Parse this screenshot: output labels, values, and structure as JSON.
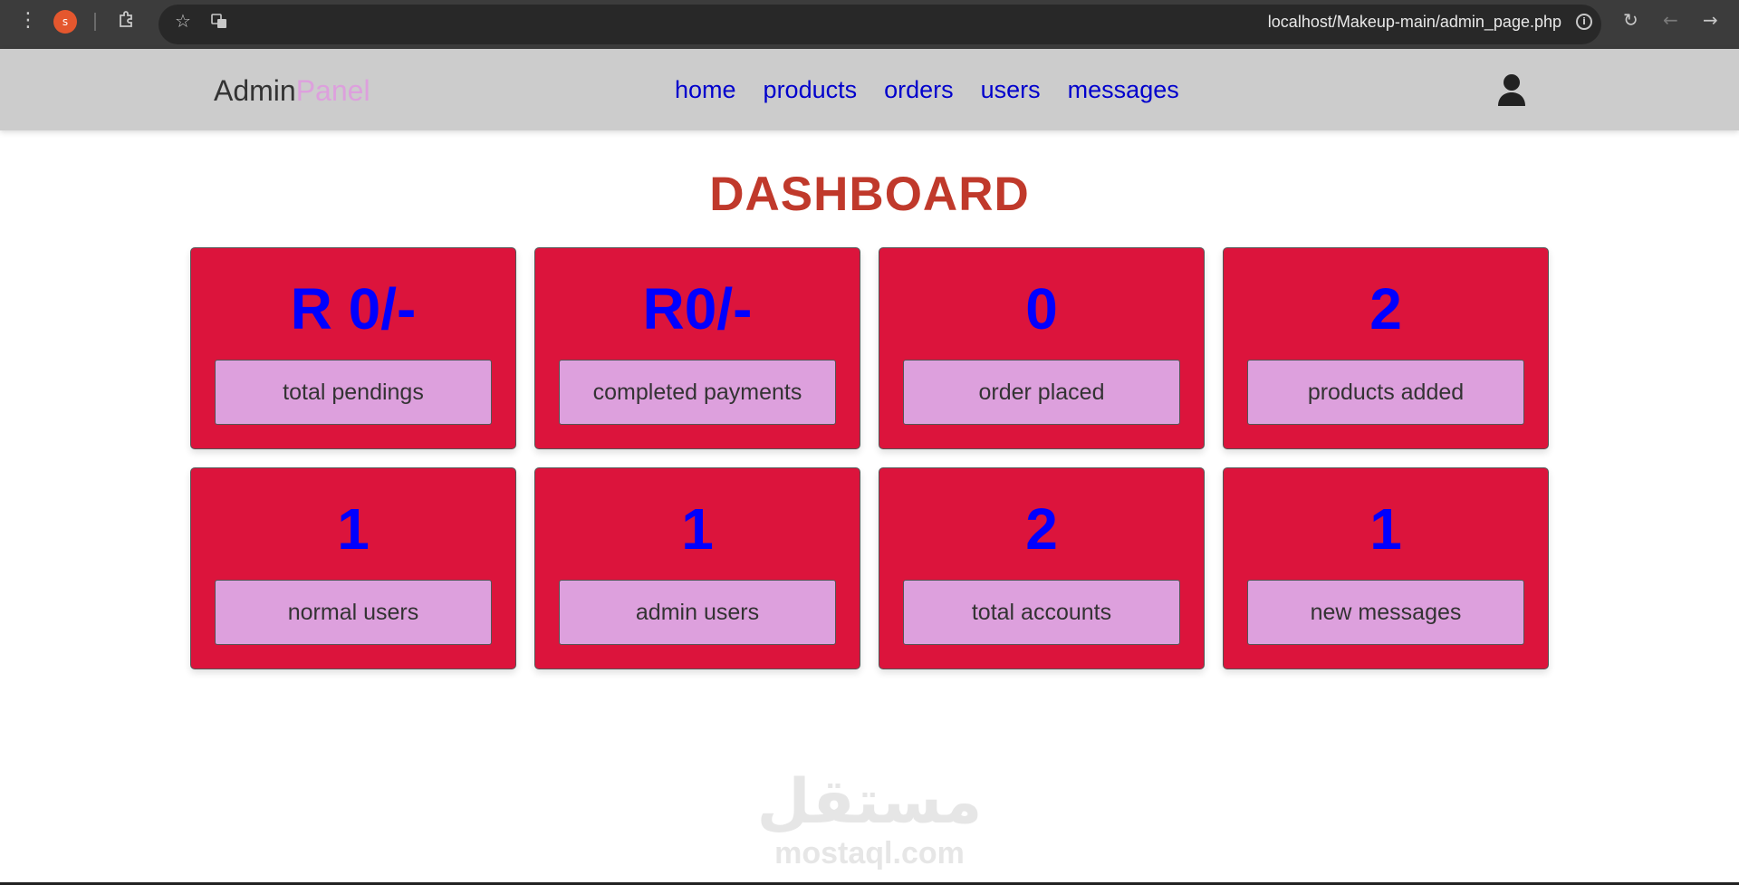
{
  "browser": {
    "profile_initial": "s",
    "url": "localhost/Makeup-main/admin_page.php",
    "icons": [
      "menu-dots-icon",
      "extensions-icon",
      "star-icon",
      "translate-icon",
      "info-icon",
      "reload-icon",
      "back-icon",
      "forward-icon"
    ]
  },
  "header": {
    "logo_main": "Admin",
    "logo_accent": "Panel",
    "nav": [
      "home",
      "products",
      "orders",
      "users",
      "messages"
    ],
    "user_icon": "user-icon"
  },
  "main": {
    "title": "DASHBOARD",
    "cards": [
      {
        "value": "R 0/-",
        "label": "total pendings"
      },
      {
        "value": "R0/-",
        "label": "completed payments"
      },
      {
        "value": "0",
        "label": "order placed"
      },
      {
        "value": "2",
        "label": "products added"
      },
      {
        "value": "1",
        "label": "normal users"
      },
      {
        "value": "1",
        "label": "admin users"
      },
      {
        "value": "2",
        "label": "total accounts"
      },
      {
        "value": "1",
        "label": "new messages"
      }
    ]
  },
  "watermark": {
    "arabic": "مستقل",
    "latin": "mostaql.com"
  },
  "colors": {
    "card_bg": "#dc143c",
    "card_value": "#0000ff",
    "label_bg": "#dda0dd",
    "title": "#c0392b",
    "nav_link": "#0000cc",
    "header_bg": "#cccccc"
  }
}
